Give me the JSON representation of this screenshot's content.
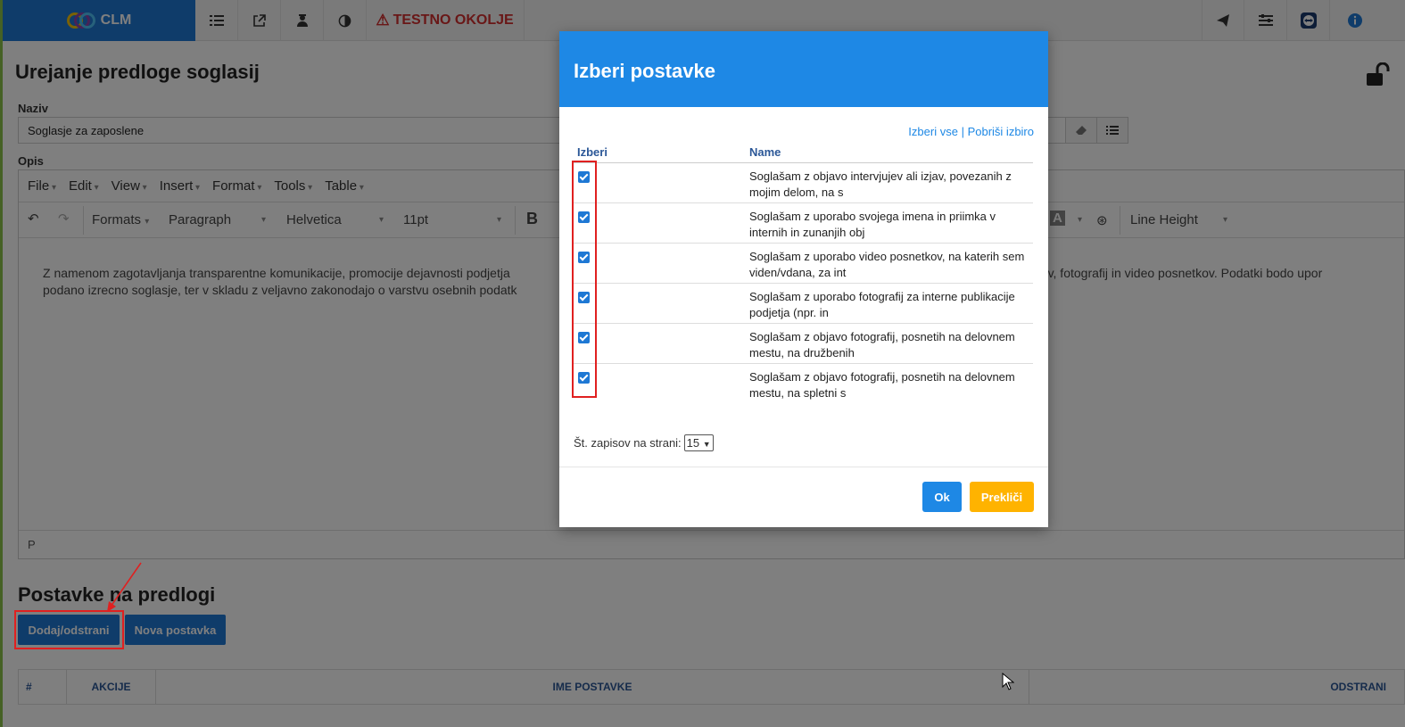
{
  "app": {
    "brand": "CLM",
    "environment_warning": "TESTNO OKOLJE"
  },
  "page": {
    "title": "Urejanje predloge soglasij",
    "naziv_label": "Naziv",
    "naziv_value": "Soglasje za zaposlene",
    "opis_label": "Opis"
  },
  "editor": {
    "menu": [
      "File",
      "Edit",
      "View",
      "Insert",
      "Format",
      "Tools",
      "Table"
    ],
    "formats": "Formats",
    "block": "Paragraph",
    "font": "Helvetica",
    "size": "11pt",
    "bold": "B",
    "line_height": "Line Height",
    "body_line1_left": "Z namenom zagotavljanja transparentne komunikacije, promocije dejavnosti podjetja",
    "body_line1_right": "podatkov, fotografij in video posnetkov. Podatki bodo upor",
    "body_line2": "podano izrecno soglasje, ter v skladu z veljavno zakonodajo o varstvu osebnih podatk",
    "status_path": "P"
  },
  "items_section": {
    "title": "Postavke na predlogi",
    "add_remove_button": "Dodaj/odstrani",
    "new_item_button": "Nova postavka",
    "columns": [
      "#",
      "AKCIJE",
      "IME POSTAVKE",
      "ODSTRANI"
    ]
  },
  "modal": {
    "title": "Izberi postavke",
    "select_all": "Izberi vse",
    "separator": "|",
    "clear_selection": "Pobriši izbiro",
    "col_select": "Izberi",
    "col_name": "Name",
    "rows": [
      {
        "checked": true,
        "name": "Soglašam z objavo intervjujev ali izjav, povezanih z mojim delom, na s"
      },
      {
        "checked": true,
        "name": "Soglašam z uporabo svojega imena in priimka v internih in zunanjih obj"
      },
      {
        "checked": true,
        "name": "Soglašam z uporabo video posnetkov, na katerih sem viden/vdana, za int"
      },
      {
        "checked": true,
        "name": "Soglašam z uporabo fotografij za interne publikacije podjetja (npr. in"
      },
      {
        "checked": true,
        "name": "Soglašam z objavo fotografij, posnetih na delovnem mestu, na družbenih"
      },
      {
        "checked": true,
        "name": "Soglašam z objavo fotografij, posnetih na delovnem mestu, na spletni s"
      }
    ],
    "per_page_label": "Št. zapisov na strani:",
    "per_page_value": "15",
    "ok_button": "Ok",
    "cancel_button": "Prekliči"
  },
  "colors": {
    "brand_blue": "#1e78d4",
    "modal_header": "#1e88e5",
    "warning_red": "#d32f2f",
    "cancel_amber": "#ffb300",
    "annotation_red": "#e02020"
  }
}
